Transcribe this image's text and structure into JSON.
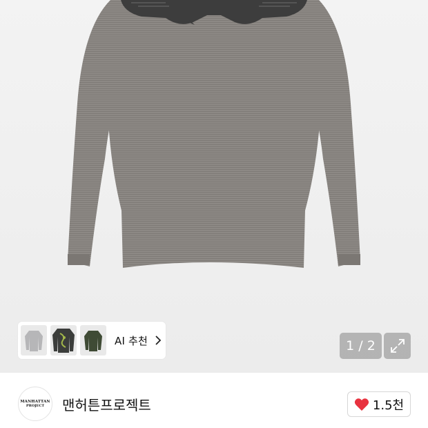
{
  "product": {
    "image_alt": "gray striped long-sleeve tee with eagle print",
    "colors": {
      "shirt": "#8c8884",
      "shirt_dark": "#7a7672",
      "print": "#3e3e3e",
      "background": "#efefef"
    }
  },
  "ai_recommend": {
    "label": "AI 추천",
    "thumbnails": [
      "light-gray-sweater",
      "dark-graphic-tee",
      "olive-long-sleeve"
    ]
  },
  "gallery": {
    "page_indicator": "1 / 2",
    "current_page": 1,
    "total_pages": 2
  },
  "store": {
    "logo_line1": "MANHATTAN",
    "logo_line2": "PROJECT",
    "name": "맨허튼프로젝트",
    "like_count": "1.5천",
    "like_color": "#e8323f"
  }
}
